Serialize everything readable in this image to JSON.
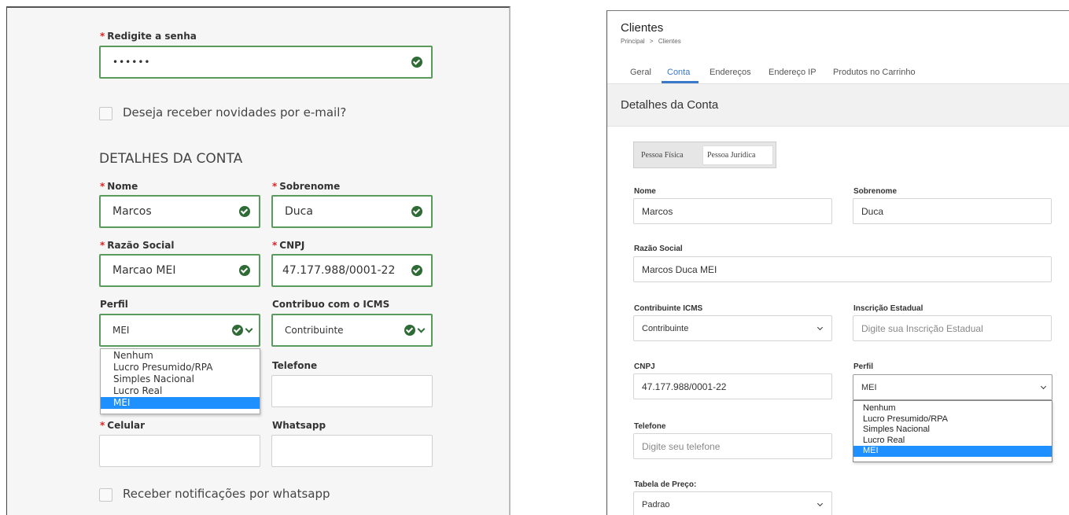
{
  "left": {
    "retype_password": {
      "label": "Redigite a senha",
      "required_mark": "*",
      "value": "••••••"
    },
    "newsletter_label": "Deseja receber novidades por e-mail?",
    "section_title": "DETALHES DA CONTA",
    "nome": {
      "label": "Nome",
      "value": "Marcos"
    },
    "sobrenome": {
      "label": "Sobrenome",
      "value": "Duca"
    },
    "razao_social": {
      "label": "Razão Social",
      "value": "Marcao MEI"
    },
    "cnpj": {
      "label": "CNPJ",
      "value": "47.177.988/0001-22"
    },
    "perfil": {
      "label": "Perfil",
      "value": "MEI",
      "options": [
        "Nenhum",
        "Lucro Presumido/RPA",
        "Simples Nacional",
        "Lucro Real",
        "MEI"
      ],
      "selected_index": 4
    },
    "icms": {
      "label": "Contribuo com o ICMS",
      "value": "Contribuinte"
    },
    "telefone": {
      "label": "Telefone"
    },
    "celular": {
      "label": "Celular"
    },
    "whatsapp": {
      "label": "Whatsapp"
    },
    "whatsapp_notify_label": "Receber notificações por whatsapp"
  },
  "right": {
    "title": "Clientes",
    "breadcrumb": {
      "home": "Principal",
      "separator": ">",
      "current": "Clientes"
    },
    "tabs": [
      "Geral",
      "Conta",
      "Endereços",
      "Endereço IP",
      "Produtos no Carrinho"
    ],
    "active_tab_index": 1,
    "section_title": "Detalhes da Conta",
    "person_type": [
      "Pessoa Física",
      "Pessoa Jurídica"
    ],
    "nome": {
      "label": "Nome",
      "value": "Marcos"
    },
    "sobrenome": {
      "label": "Sobrenome",
      "value": "Duca"
    },
    "razao_social": {
      "label": "Razão Social",
      "value": "Marcos Duca MEI"
    },
    "contribuinte_icms": {
      "label": "Contribuinte ICMS",
      "value": "Contribuinte"
    },
    "inscricao_estadual": {
      "label": "Inscrição Estadual",
      "placeholder": "Digite sua Inscrição Estadual"
    },
    "cnpj": {
      "label": "CNPJ",
      "value": "47.177.988/0001-22"
    },
    "perfil": {
      "label": "Perfil",
      "value": "MEI",
      "options": [
        "Nenhum",
        "Lucro Presumido/RPA",
        "Simples Nacional",
        "Lucro Real",
        "MEI"
      ],
      "selected_index": 4
    },
    "telefone": {
      "label": "Telefone",
      "placeholder": "Digite seu telefone"
    },
    "tabela_preco": {
      "label": "Tabela de Preço:",
      "value": "Padrao"
    }
  },
  "colors": {
    "valid_green": "#2e6b35",
    "valid_border": "#5a9a5c",
    "required_red": "#d22222",
    "selected_option": "#1e90ff",
    "active_tab": "#3a78c9"
  }
}
